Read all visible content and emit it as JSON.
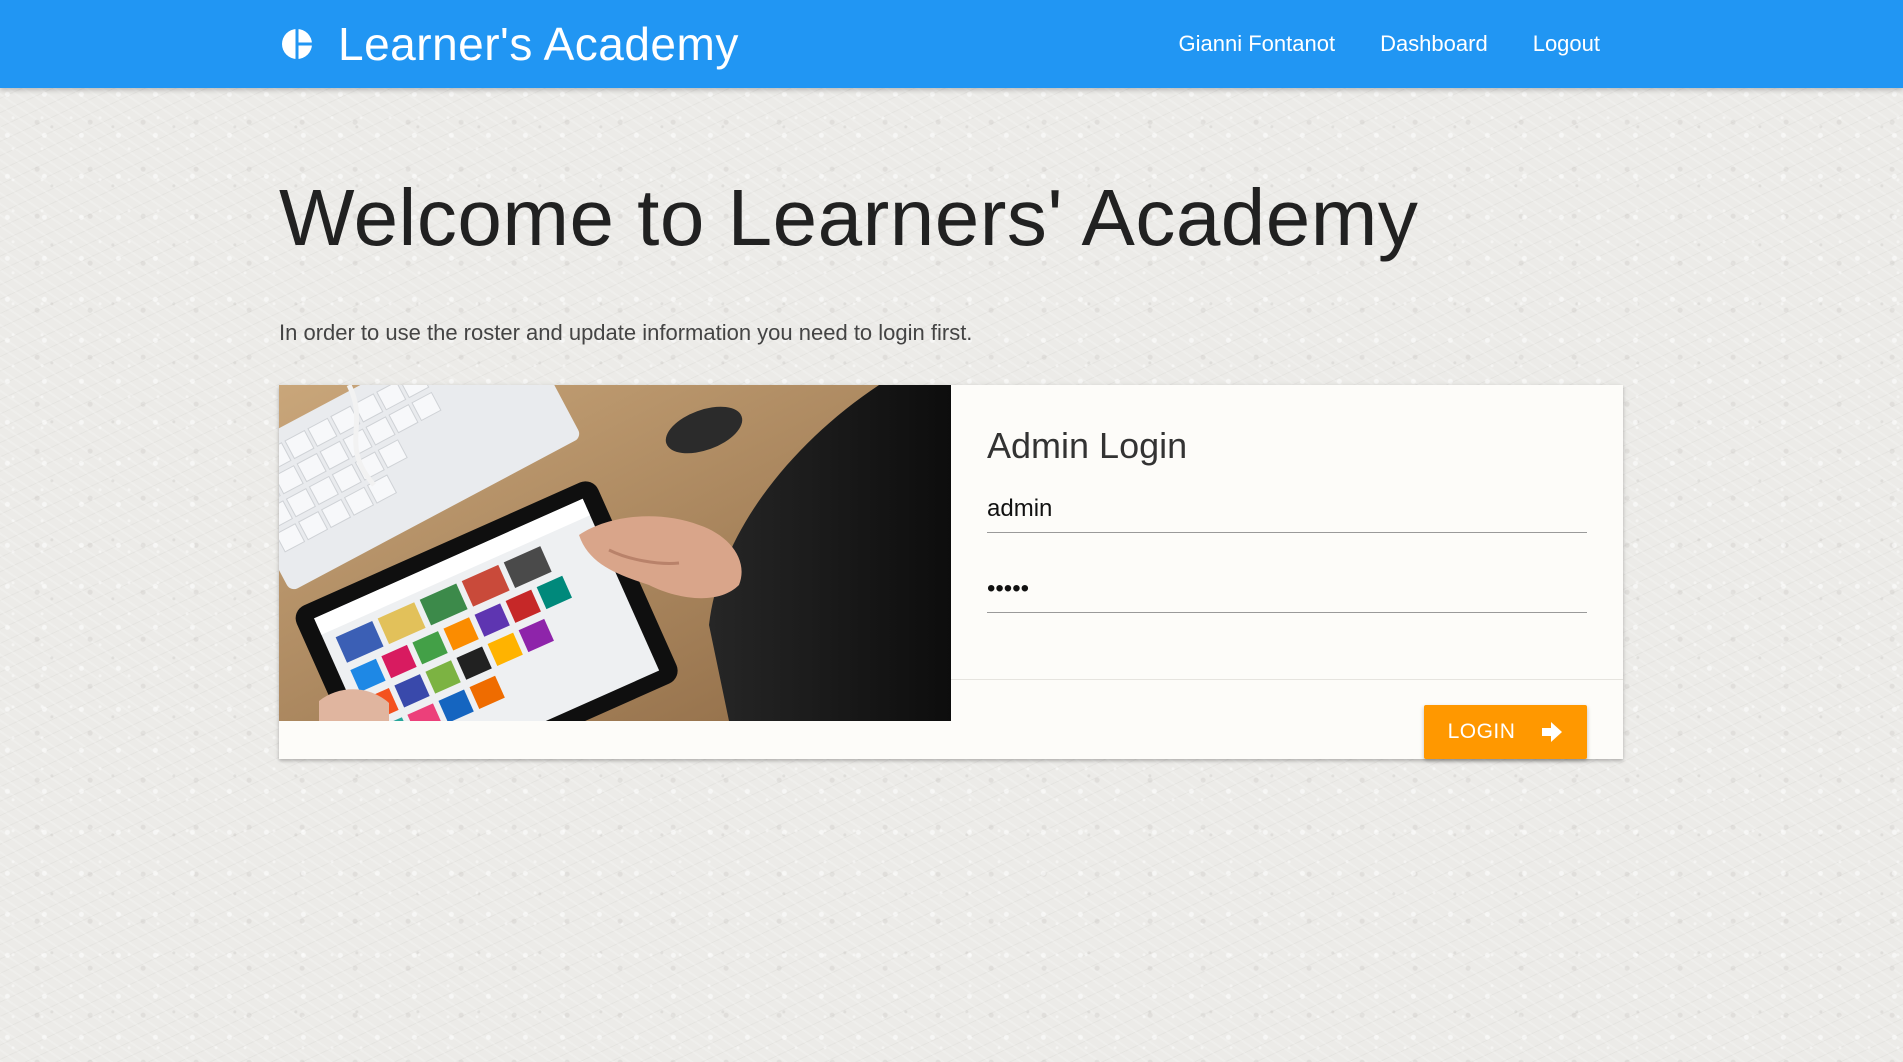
{
  "navbar": {
    "brand_icon": "pie-chart-icon",
    "brand": "Learner's Academy",
    "links": [
      "Gianni Fontanot",
      "Dashboard",
      "Logout"
    ],
    "color": "#2196f3"
  },
  "main": {
    "title": "Welcome to Learners' Academy",
    "intro": "In order to use the roster and update information you need to login first."
  },
  "login_card": {
    "image": "tablet-photo",
    "title": "Admin Login",
    "username_value": "admin",
    "password_value": "admin",
    "button_label": "LOGIN",
    "button_icon": "arrow-right-icon",
    "button_color": "#ff9800"
  }
}
